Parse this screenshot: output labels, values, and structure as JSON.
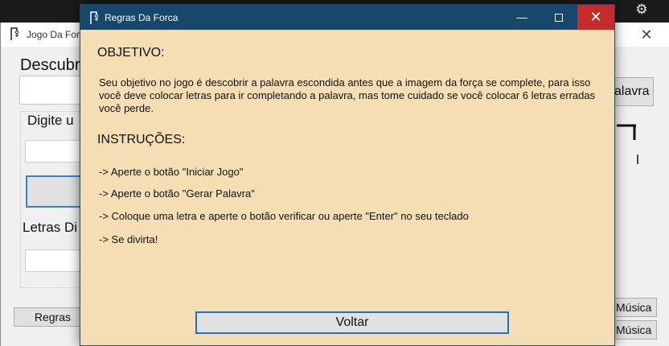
{
  "background_window": {
    "title": "Jogo Da Forca",
    "descubra_label": "Descubr",
    "digite_label": "Digite u",
    "letras_label": "Letras Di",
    "regras_button": "Regras",
    "gerar_button": "alavra",
    "musica_button_1": "Música",
    "musica_button_2": "Música"
  },
  "dialog": {
    "title": "Regras Da Forca",
    "objective_heading": "OBJETIVO:",
    "objective_text": "Seu objetivo no jogo é descobrir a palavra escondida antes que a imagem da força se complete, para isso você deve colocar letras para ir completando a palavra, mas tome cuidado se você colocar 6 letras erradas você perde.",
    "instructions_heading": "INSTRUÇÕES:",
    "instructions": [
      "-> Aperte o botão \"Iniciar Jogo\"",
      "-> Aperte o botão \"Gerar Palavra\"",
      "-> Coloque uma letra e aperte o botão verificar ou aperte \"Enter\" no seu teclado",
      "-> Se divirta!"
    ],
    "back_button": "Voltar"
  },
  "colors": {
    "dialog_background": "#f5deb3",
    "titlebar": "#17486c",
    "close_hover": "#c42b2b",
    "button_focus_border": "#1f6fc4"
  }
}
